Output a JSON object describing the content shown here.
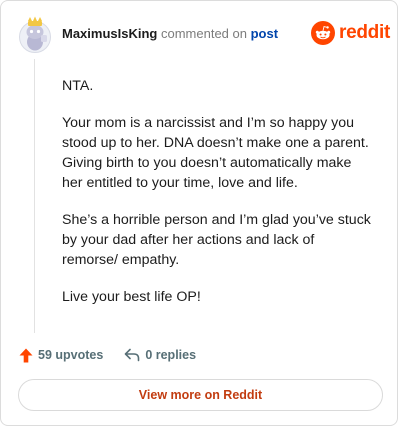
{
  "header": {
    "username": "MaximusIsKing",
    "action_text": "commented on",
    "post_link": "post",
    "avatar_icon": "snoo-avatar-icon",
    "brand_icon": "reddit-logo-icon",
    "brand_name": "reddit"
  },
  "comment": {
    "paragraphs": [
      "NTA.",
      "Your mom is a narcissist and I’m so happy you stood up to her. DNA doesn’t make one a parent. Giving birth to you doesn’t automatically make her entitled to your time, love and life.",
      "She’s a horrible person and I’m glad you’ve stuck by your dad after her actions and lack of remorse/ empathy.",
      "Live your best life OP!"
    ]
  },
  "actions": {
    "upvotes_label": "59 upvotes",
    "upvote_icon": "upvote-arrow-icon",
    "replies_label": "0 replies",
    "reply_icon": "reply-arrow-icon"
  },
  "footer": {
    "view_more_label": "View more on Reddit"
  },
  "colors": {
    "brand": "#ff4500",
    "link": "#0045ac",
    "muted": "#576f76",
    "view_more_text": "#c23c10",
    "border": "#dcdcdc"
  }
}
